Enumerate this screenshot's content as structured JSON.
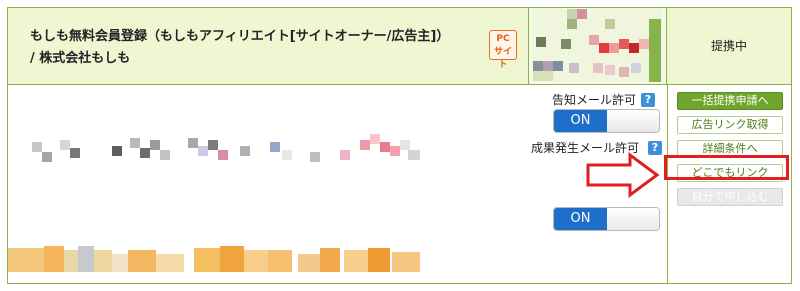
{
  "program": {
    "title": "もしも無料会員登録（もしもアフィリエイト[サイトオーナー/広告主]） / 株式会社もしも",
    "device_badge_line1": "PC",
    "device_badge_line2": "サイト",
    "status": "提携中"
  },
  "settings": {
    "mail_label": "告知メール許可",
    "mail_toggle": "ON",
    "result_label": "成果発生メール許可",
    "result_toggle": "ON",
    "help_glyph": "?"
  },
  "actions": {
    "bulk_apply": "一括提携申請へ",
    "get_ad_link": "広告リンク取得",
    "details": "詳細条件へ",
    "dokodemo_link": "どこでもリンク",
    "self_apply": "自分で申し込む"
  },
  "colors": {
    "border": "#8fb14a",
    "header_bg": "#eef7d2",
    "accent_green": "#6fa52c",
    "toggle_blue": "#1e6fc8",
    "highlight_red": "#e01f1f"
  },
  "icons": {
    "help": "question-icon",
    "arrow": "right-arrow-annotation"
  }
}
